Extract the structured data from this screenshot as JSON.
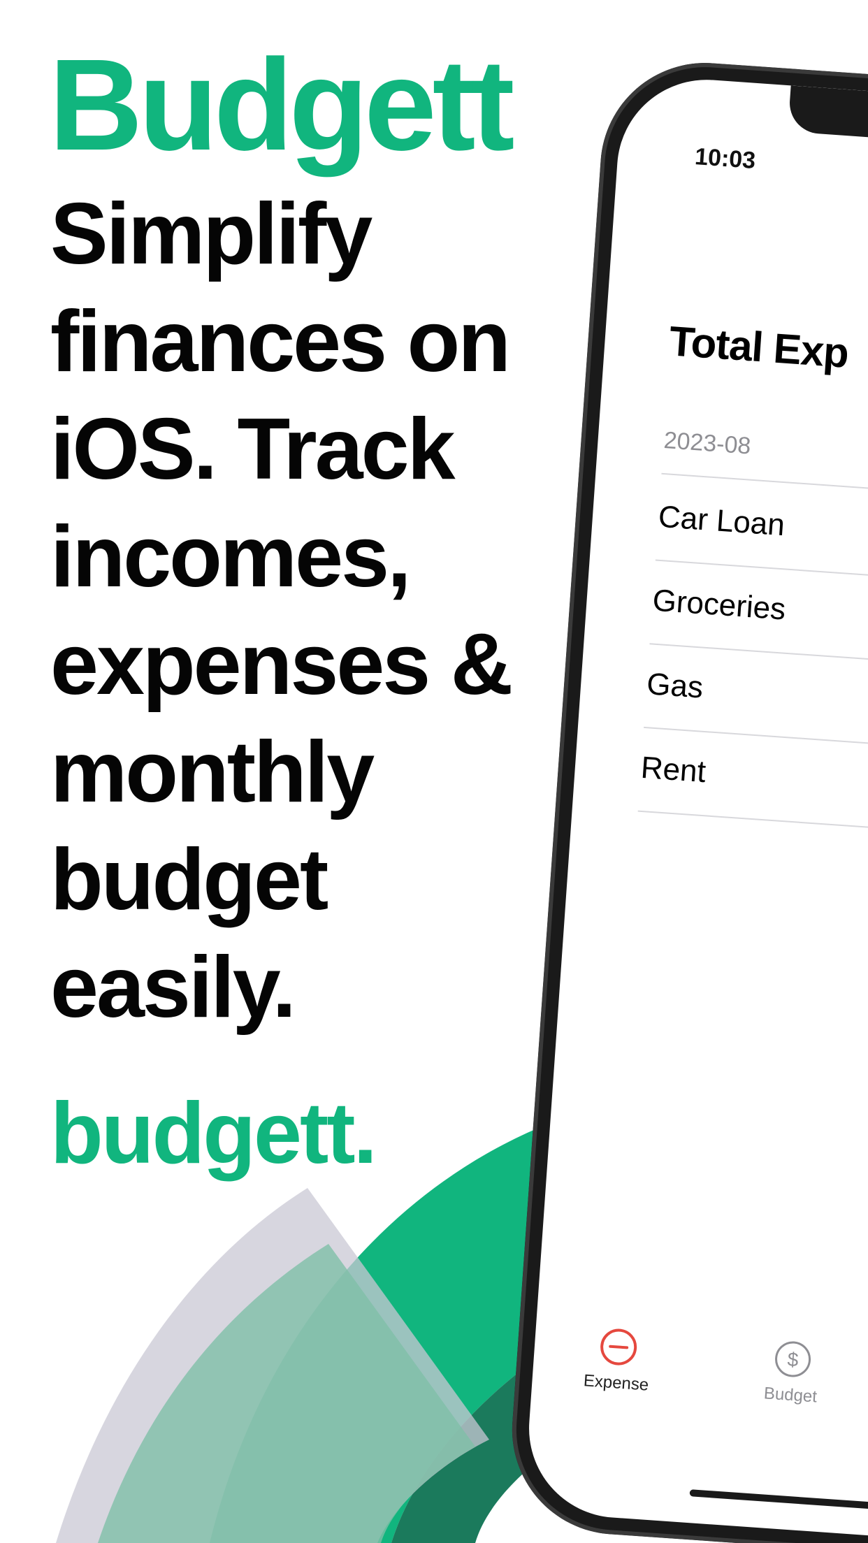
{
  "headline": {
    "brand": "Budgett",
    "tagline_lines": [
      "Simplify",
      "finances on",
      "iOS. Track",
      "incomes,",
      "expenses &",
      "monthly",
      "budget",
      "easily."
    ],
    "footer_brand": "budgett."
  },
  "phone": {
    "status_time": "10:03",
    "title": "Total Exp",
    "section_header": "2023-08",
    "rows": [
      "Car Loan",
      "Groceries",
      "Gas",
      "Rent"
    ],
    "tabs": [
      {
        "label": "Expense",
        "icon": "minus-circle-icon",
        "active": true
      },
      {
        "label": "Budget",
        "icon": "dollar-circle-icon",
        "active": false
      }
    ]
  },
  "colors": {
    "brand_green": "#11b57e",
    "dark_green": "#1b7a5c",
    "arc_gray": "#d7d6df",
    "text_black": "#050505",
    "active_tab_red": "#e5483e",
    "inactive_tab_gray": "#8e8e93"
  }
}
